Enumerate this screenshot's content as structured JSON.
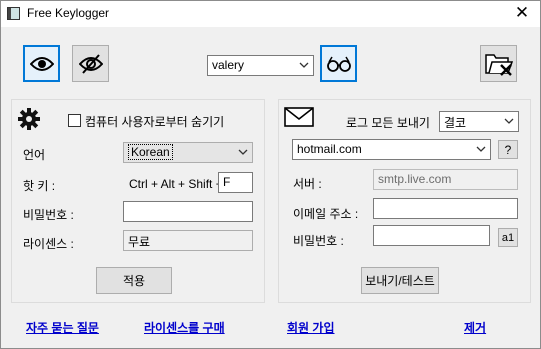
{
  "window": {
    "title": "Free Keylogger",
    "close_glyph": "✕"
  },
  "toolbar": {
    "user_combo_value": "valery",
    "icons": [
      "eye-icon",
      "eye-slash-icon",
      "glasses-icon",
      "folder-delete-icon"
    ]
  },
  "left_panel": {
    "hide_checkbox_label": "컴퓨터 사용자로부터 숨기기",
    "hide_checked": false,
    "language_label": "언어",
    "language_value": "Korean",
    "hotkey_label": "핫 키 :",
    "hotkey_combo": "Ctrl + Alt + Shift +",
    "hotkey_key": "F",
    "password_label": "비밀번호 :",
    "password_value": "",
    "license_label": "라이센스 :",
    "license_value": "무료",
    "apply_button": "적용"
  },
  "right_panel": {
    "send_logs_label": "로그 모든 보내기",
    "send_interval_value": "결코",
    "provider_value": "hotmail.com",
    "help_button": "?",
    "server_label": "서버 :",
    "server_value": "smtp.live.com",
    "email_label": "이메일 주소 :",
    "email_value": "",
    "password_label": "비밀번호 :",
    "password_value": "",
    "show_password_button": "a1",
    "send_test_button": "보내기/테스트"
  },
  "footer_links": {
    "faq": "자주 묻는 질문",
    "buy_license": "라이센스를 구매",
    "register": "회원 가입",
    "uninstall": "제거"
  },
  "colors": {
    "accent": "#0078d7",
    "link": "#0000cc"
  }
}
